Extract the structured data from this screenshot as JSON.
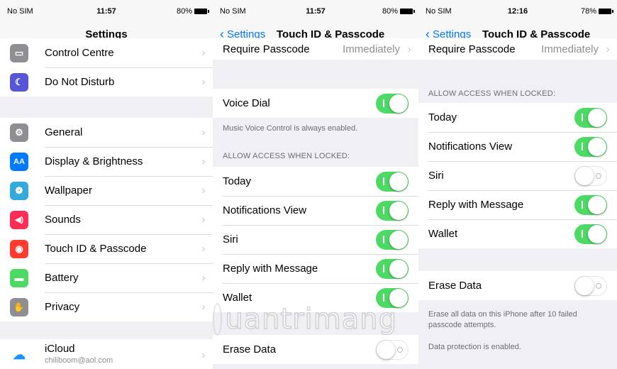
{
  "status_bars": [
    {
      "carrier": "No SIM",
      "time": "11:57",
      "battery": "80%"
    },
    {
      "carrier": "No SIM",
      "time": "11:57",
      "battery": "80%"
    },
    {
      "carrier": "No SIM",
      "time": "12:16",
      "battery": "78%"
    }
  ],
  "panel1": {
    "title": "Settings",
    "items": [
      {
        "label": "Control Centre",
        "icon": "control-centre-icon",
        "color": "#8e8e93"
      },
      {
        "label": "Do Not Disturb",
        "icon": "moon-icon",
        "color": "#5856d6"
      },
      {
        "label": "General",
        "icon": "gear-icon",
        "color": "#8e8e93"
      },
      {
        "label": "Display & Brightness",
        "icon": "display-icon",
        "color": "#007aff",
        "glyph": "AA"
      },
      {
        "label": "Wallpaper",
        "icon": "wallpaper-icon",
        "color": "#34aadc"
      },
      {
        "label": "Sounds",
        "icon": "speaker-icon",
        "color": "#ff2d55"
      },
      {
        "label": "Touch ID & Passcode",
        "icon": "fingerprint-icon",
        "color": "#ff3b30"
      },
      {
        "label": "Battery",
        "icon": "battery-icon",
        "color": "#4cd964"
      },
      {
        "label": "Privacy",
        "icon": "hand-icon",
        "color": "#8e8e93"
      },
      {
        "label": "iCloud",
        "sublabel": "chiliboom@aol.com",
        "icon": "cloud-icon",
        "color": "#ffffff"
      }
    ]
  },
  "panel2": {
    "back": "Settings",
    "title": "Touch ID & Passcode",
    "require_passcode": {
      "label": "Require Passcode",
      "value": "Immediately"
    },
    "voice_dial": {
      "label": "Voice Dial",
      "on": true
    },
    "voice_dial_footer": "Music Voice Control is always enabled.",
    "locked_header": "ALLOW ACCESS WHEN LOCKED:",
    "locked_items": [
      {
        "label": "Today",
        "on": true
      },
      {
        "label": "Notifications View",
        "on": true
      },
      {
        "label": "Siri",
        "on": true
      },
      {
        "label": "Reply with Message",
        "on": true
      },
      {
        "label": "Wallet",
        "on": true
      }
    ],
    "erase_data": {
      "label": "Erase Data",
      "on": false
    }
  },
  "panel3": {
    "back": "Settings",
    "title": "Touch ID & Passcode",
    "require_passcode": {
      "label": "Require Passcode",
      "value": "Immediately"
    },
    "locked_header": "ALLOW ACCESS WHEN LOCKED:",
    "locked_items": [
      {
        "label": "Today",
        "on": true
      },
      {
        "label": "Notifications View",
        "on": true
      },
      {
        "label": "Siri",
        "on": false
      },
      {
        "label": "Reply with Message",
        "on": true
      },
      {
        "label": "Wallet",
        "on": true
      }
    ],
    "erase_data": {
      "label": "Erase Data",
      "on": false
    },
    "erase_footer": "Erase all data on this iPhone after 10 failed passcode attempts.",
    "protection_footer": "Data protection is enabled."
  },
  "watermark": "uantrimang",
  "colors": {
    "accent": "#007aff",
    "switch_on": "#4cd964"
  }
}
